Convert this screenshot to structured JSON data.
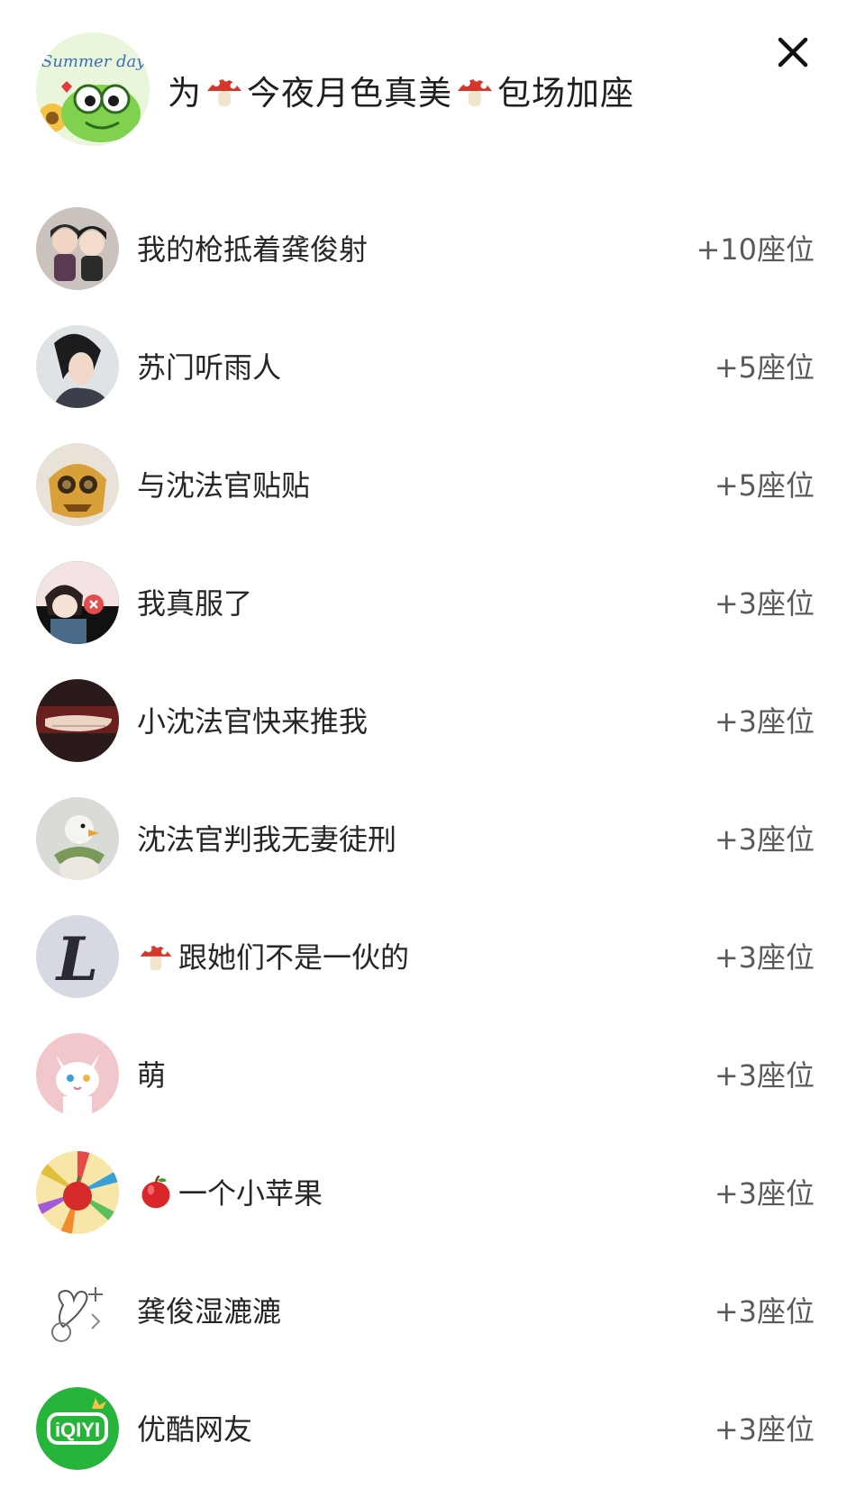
{
  "header": {
    "title_parts": [
      "为",
      "今夜月色真美",
      "包场加座"
    ],
    "avatar_text": "Summer day",
    "close_icon": "close-icon",
    "title_emoji": "mushroom-icon"
  },
  "rows": [
    {
      "name": "我的枪抵着龚俊射",
      "seats": "+10座位",
      "avatar": "avatar-dolls"
    },
    {
      "name": "苏门听雨人",
      "seats": "+5座位",
      "avatar": "avatar-portrait"
    },
    {
      "name": "与沈法官贴贴",
      "seats": "+5座位",
      "avatar": "avatar-lion-mask"
    },
    {
      "name": "我真服了",
      "seats": "+3座位",
      "avatar": "avatar-cartoon"
    },
    {
      "name": "小沈法官快来推我",
      "seats": "+3座位",
      "avatar": "avatar-hands"
    },
    {
      "name": "沈法官判我无妻徒刑",
      "seats": "+3座位",
      "avatar": "avatar-bird"
    },
    {
      "name": "跟她们不是一伙的",
      "seats": "+3座位",
      "avatar": "avatar-letter-l",
      "leading_emoji": "mushroom-icon"
    },
    {
      "name": "萌",
      "seats": "+3座位",
      "avatar": "avatar-cat"
    },
    {
      "name": "一个小苹果",
      "seats": "+3座位",
      "avatar": "avatar-apple-burst",
      "leading_emoji": "apple-icon"
    },
    {
      "name": "龚俊湿漉漉",
      "seats": "+3座位",
      "avatar": "avatar-sketch"
    },
    {
      "name": "优酷网友",
      "seats": "+3座位",
      "avatar": "avatar-iqiyi-logo"
    }
  ],
  "avatar_logo_text": "iQIYI",
  "avatar_letter": "L",
  "colors": {
    "title": "#1f1f1f",
    "name": "#262626",
    "seats": "#5a5a5a",
    "mushroom_cap": "#d9362b",
    "iqiyi_green": "#27b43b"
  }
}
